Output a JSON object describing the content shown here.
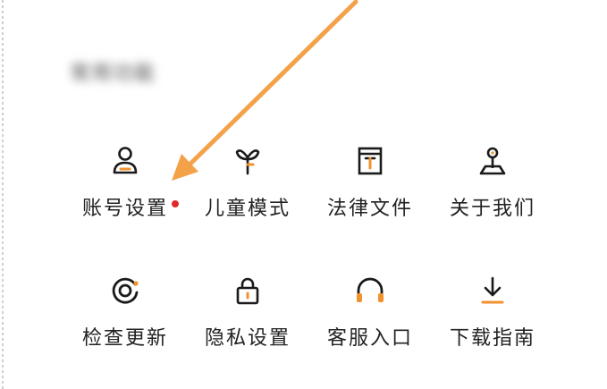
{
  "section": {
    "title": "常用功能"
  },
  "menu": {
    "row1": [
      {
        "label": "账号设置",
        "icon": "account-icon",
        "badge": true
      },
      {
        "label": "儿童模式",
        "icon": "sprout-icon"
      },
      {
        "label": "法律文件",
        "icon": "document-icon"
      },
      {
        "label": "关于我们",
        "icon": "location-pin-icon"
      }
    ],
    "row2": [
      {
        "label": "检查更新",
        "icon": "refresh-icon"
      },
      {
        "label": "隐私设置",
        "icon": "lock-icon"
      },
      {
        "label": "客服入口",
        "icon": "headphones-icon"
      },
      {
        "label": "下载指南",
        "icon": "download-icon"
      }
    ]
  },
  "colors": {
    "accent": "#f0922e",
    "badge": "#e02a2a",
    "icon_stroke": "#1a1a1a",
    "annotation_arrow": "#f3a24a"
  }
}
